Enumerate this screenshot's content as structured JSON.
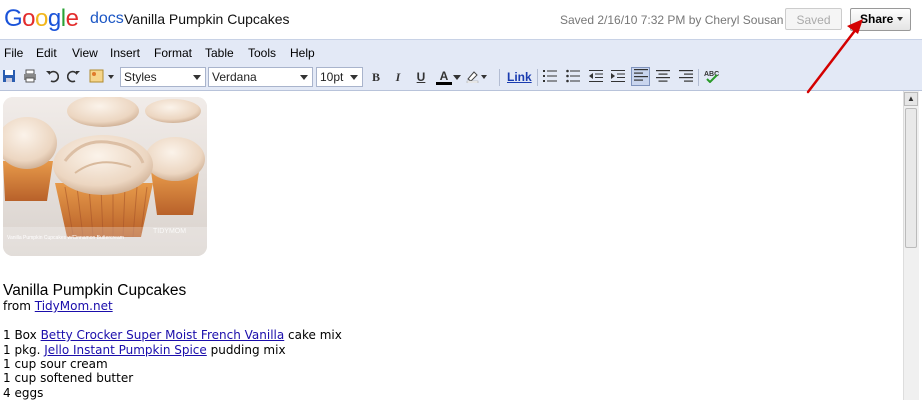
{
  "header": {
    "logo_text": "Google",
    "product": "docs",
    "doc_title": "Vanilla Pumpkin Cupcakes",
    "saved_status": "Saved 2/16/10 7:32 PM by Cheryl Sousan",
    "saved_button": "Saved",
    "share_button": "Share"
  },
  "menu": [
    "File",
    "Edit",
    "View",
    "Insert",
    "Format",
    "Table",
    "Tools",
    "Help"
  ],
  "toolbar": {
    "styles": "Styles",
    "font": "Verdana",
    "size": "10pt",
    "bold": "B",
    "italic": "I",
    "underline": "U",
    "text_color": "A",
    "link": "Link"
  },
  "document": {
    "image_caption": "Vanilla Pumpkin Cupcakes w/Cinnamon Buttercream",
    "image_watermark": "TIDYMOM",
    "heading": "Vanilla Pumpkin Cupcakes",
    "from_label": "from ",
    "from_link": "TidyMom.net",
    "ingredients": [
      {
        "prefix": "1 Box ",
        "link": "Betty Crocker Super Moist French Vanilla",
        "suffix": " cake mix"
      },
      {
        "prefix": "1 pkg. ",
        "link": "Jello Instant Pumpkin Spice",
        "suffix": " pudding mix"
      },
      {
        "prefix": "1 cup sour cream",
        "link": "",
        "suffix": ""
      },
      {
        "prefix": "1 cup softened butter",
        "link": "",
        "suffix": ""
      },
      {
        "prefix": "4 eggs",
        "link": "",
        "suffix": ""
      }
    ]
  },
  "colors": {
    "toolbar_bg": "#e3e9f6",
    "link": "#1a0dab",
    "annotation_arrow": "#d40000"
  }
}
